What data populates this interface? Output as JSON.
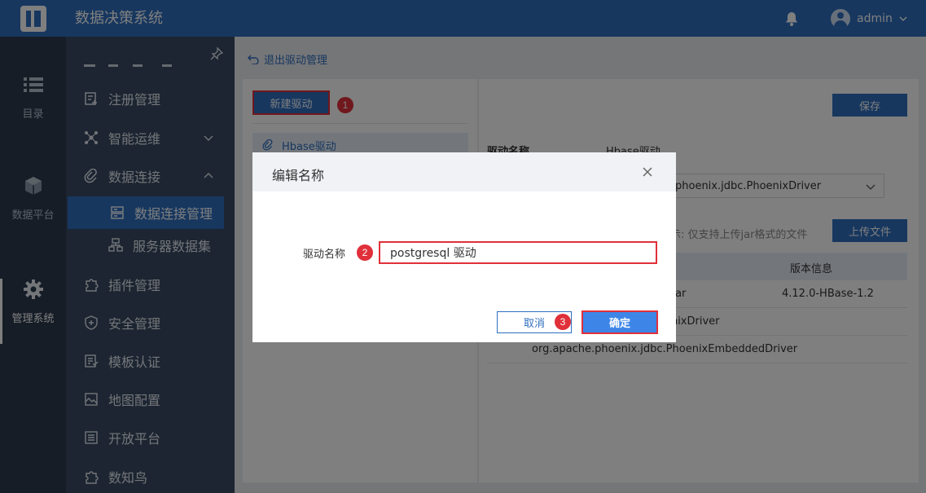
{
  "topbar": {
    "title": "数据决策系统",
    "username": "admin"
  },
  "rail": {
    "items": [
      {
        "label": "目录",
        "icon": "list-icon"
      },
      {
        "label": "数据平台",
        "icon": "cube-icon"
      },
      {
        "label": "管理系统",
        "icon": "gear-icon"
      }
    ]
  },
  "menu": {
    "items": [
      {
        "label": "注册管理",
        "icon": "register-icon"
      },
      {
        "label": "智能运维",
        "icon": "ops-icon"
      },
      {
        "label": "数据连接",
        "icon": "link-icon"
      },
      {
        "label": "数据连接管理",
        "icon": "database-icon"
      },
      {
        "label": "服务器数据集",
        "icon": "dataset-icon"
      },
      {
        "label": "插件管理",
        "icon": "puzzle-icon"
      },
      {
        "label": "安全管理",
        "icon": "shield-icon"
      },
      {
        "label": "模板认证",
        "icon": "template-icon"
      },
      {
        "label": "地图配置",
        "icon": "map-icon"
      },
      {
        "label": "开放平台",
        "icon": "platform-icon"
      },
      {
        "label": "数知鸟",
        "icon": "bird-icon"
      }
    ]
  },
  "main": {
    "back_link": "退出驱动管理",
    "new_driver_button": "新建驱动",
    "drivers": [
      {
        "name": "Hbase驱动"
      }
    ],
    "save_button": "保存",
    "driver_name_label": "驱动名称",
    "driver_name_value": "Hbase驱动",
    "driver_class": "phoenix.jdbc.PhoenixDriver",
    "upload_hint": "提示: 仅支持上传jar格式的文件",
    "upload_button": "上传文件",
    "table_header_version": "版本信息",
    "rows": [
      {
        "c1": "nt.jar",
        "c2": "4.12.0-HBase-1.2"
      },
      {
        "c1": "oenixDriver",
        "c2": ""
      },
      {
        "c1": "org.apache.phoenix.jdbc.PhoenixEmbeddedDriver",
        "c2": ""
      }
    ]
  },
  "dialog": {
    "title": "编辑名称",
    "field_label": "驱动名称",
    "field_value": "postgresql 驱动",
    "cancel": "取消",
    "confirm": "确定",
    "step1": "1",
    "step2": "2",
    "step3": "3"
  },
  "colors": {
    "brand": "#2f6fbf",
    "highlight": "#e0303a"
  }
}
